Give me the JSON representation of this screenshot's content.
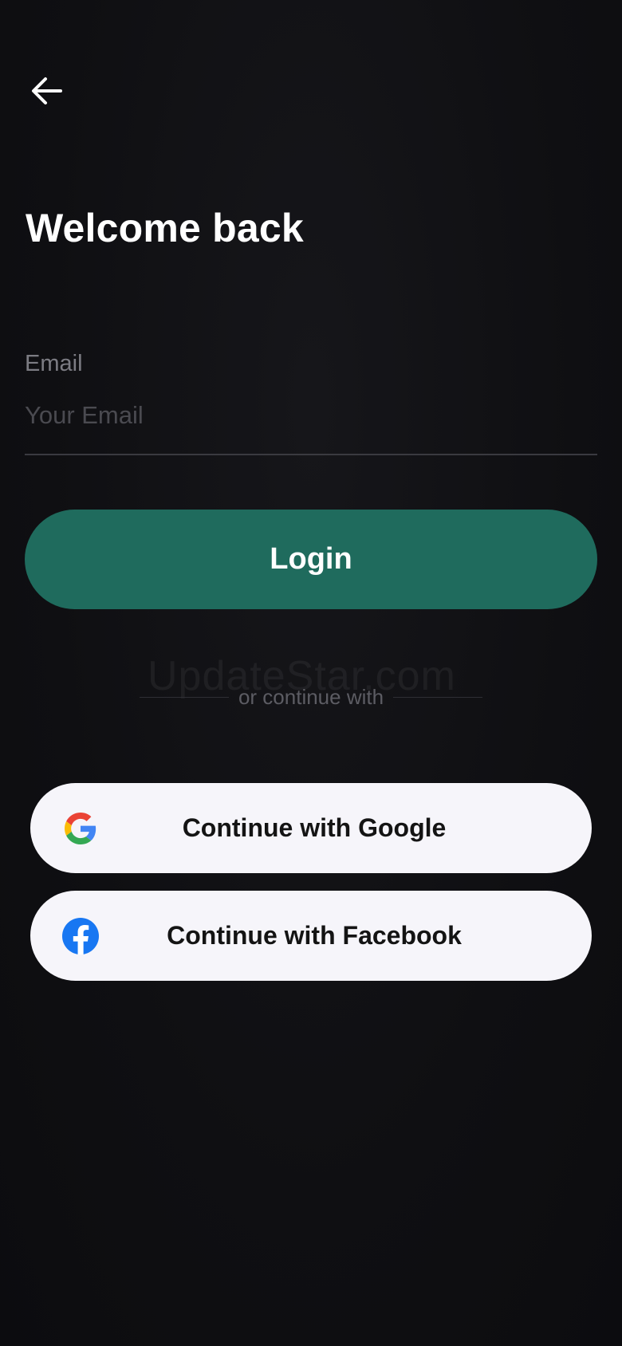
{
  "header": {
    "back_icon": "arrow-left-icon",
    "title": "Welcome back"
  },
  "form": {
    "email_label": "Email",
    "email_placeholder": "Your Email",
    "email_value": "",
    "login_label": "Login"
  },
  "divider": {
    "text": "or continue with"
  },
  "watermark": {
    "text": "UpdateStar.com"
  },
  "social": {
    "google": {
      "label": "Continue with Google",
      "icon": "google-icon"
    },
    "facebook": {
      "label": "Continue with Facebook",
      "icon": "facebook-icon"
    }
  },
  "colors": {
    "background": "#0f0f12",
    "accent": "#1f6b5d",
    "button_light": "#f6f5fa",
    "facebook_blue": "#1877f2"
  }
}
